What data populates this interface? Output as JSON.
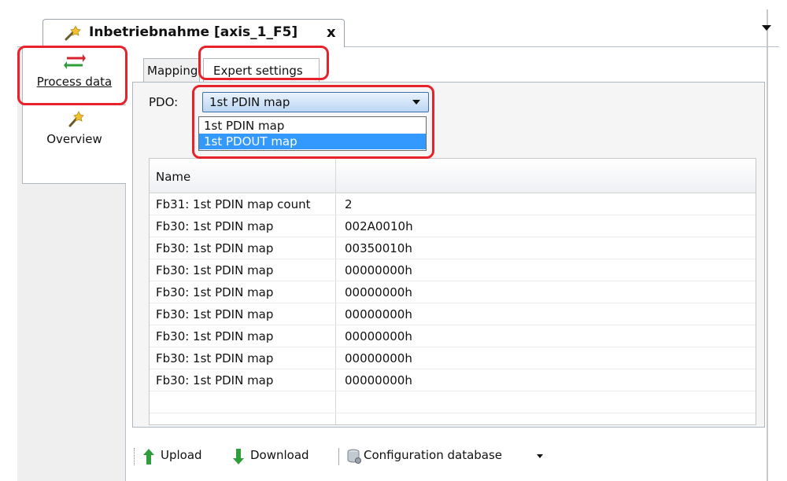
{
  "document_tab": {
    "title": "Inbetriebnahme [axis_1_F5]",
    "close_label": "x",
    "icon": "wand-icon"
  },
  "left_tabs": [
    {
      "label": "Process data",
      "icon": "arrows-exchange-icon",
      "active": true
    },
    {
      "label": "Overview",
      "icon": "wand-icon",
      "active": false
    }
  ],
  "sub_tabs": [
    {
      "label": "Mapping",
      "active": false
    },
    {
      "label": "Expert settings",
      "active": true
    }
  ],
  "pdo": {
    "label": "PDO:",
    "selected": "1st PDIN map",
    "options": [
      "1st PDIN map",
      "1st PDOUT map"
    ],
    "highlighted_option": "1st PDOUT map"
  },
  "table": {
    "header_name": "Name",
    "rows": [
      {
        "name": "Fb31: 1st PDIN map count",
        "value": "2"
      },
      {
        "name": "Fb30: 1st PDIN map",
        "value": "002A0010h"
      },
      {
        "name": "Fb30: 1st PDIN map",
        "value": "00350010h"
      },
      {
        "name": "Fb30: 1st PDIN map",
        "value": "00000000h"
      },
      {
        "name": "Fb30: 1st PDIN map",
        "value": "00000000h"
      },
      {
        "name": "Fb30: 1st PDIN map",
        "value": "00000000h"
      },
      {
        "name": "Fb30: 1st PDIN map",
        "value": "00000000h"
      },
      {
        "name": "Fb30: 1st PDIN map",
        "value": "00000000h"
      },
      {
        "name": "Fb30: 1st PDIN map",
        "value": "00000000h"
      }
    ]
  },
  "toolbar": {
    "upload_label": "Upload",
    "download_label": "Download",
    "config_db_label": "Configuration database"
  },
  "colors": {
    "highlight": "#e8222a",
    "selection": "#3399ff",
    "arrow_green": "#2e9e3a"
  }
}
